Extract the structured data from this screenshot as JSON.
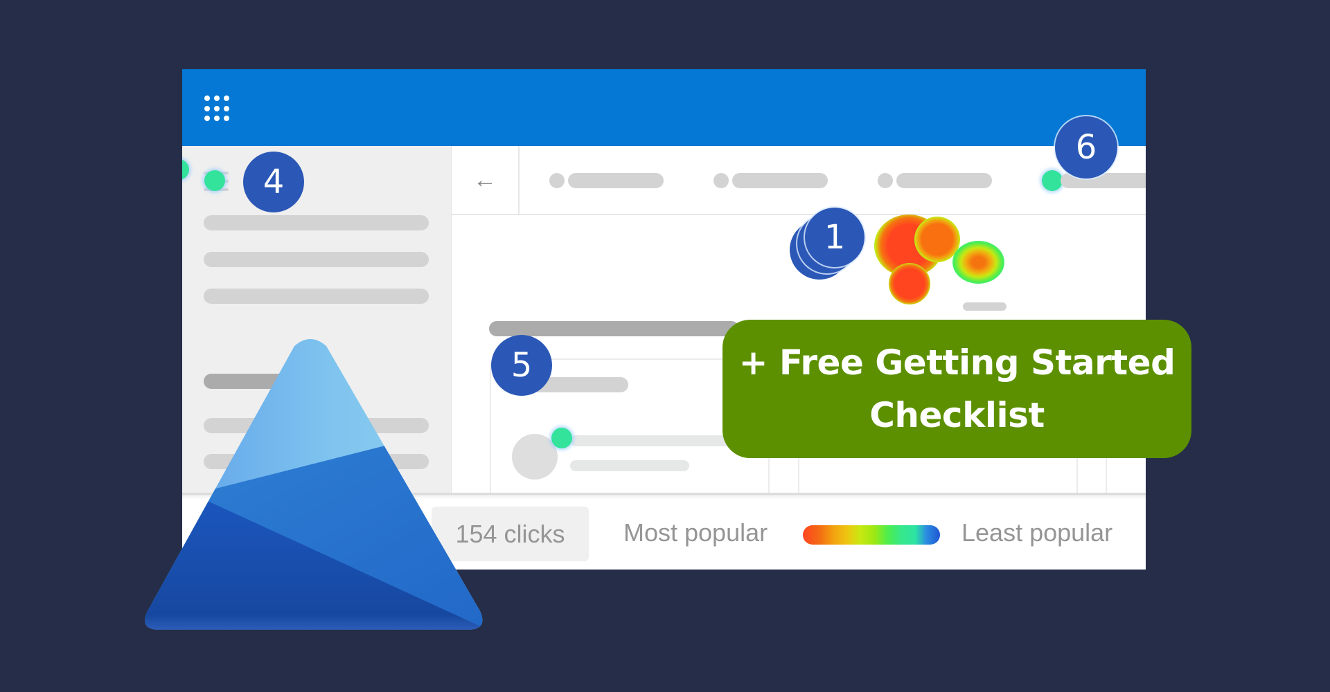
{
  "header": {
    "apps_icon": "app-launcher-grid-icon",
    "color": "#0478d4"
  },
  "toolbar": {
    "back_icon": "arrow-left-icon",
    "back_glyph": "←"
  },
  "badges": [
    {
      "id": "1",
      "label": "1"
    },
    {
      "id": "4",
      "label": "4"
    },
    {
      "id": "5",
      "label": "5"
    },
    {
      "id": "6",
      "label": "6"
    }
  ],
  "footer": {
    "clicks": "154 clicks",
    "most_popular": "Most popular",
    "least_popular": "Least popular"
  },
  "cta": {
    "line1": "+ Free Getting Started",
    "line2": "Checklist",
    "color": "#5c9000"
  },
  "colors": {
    "background": "#252d48",
    "badge": "#2b58b6",
    "click_dot": "#33e39b"
  }
}
